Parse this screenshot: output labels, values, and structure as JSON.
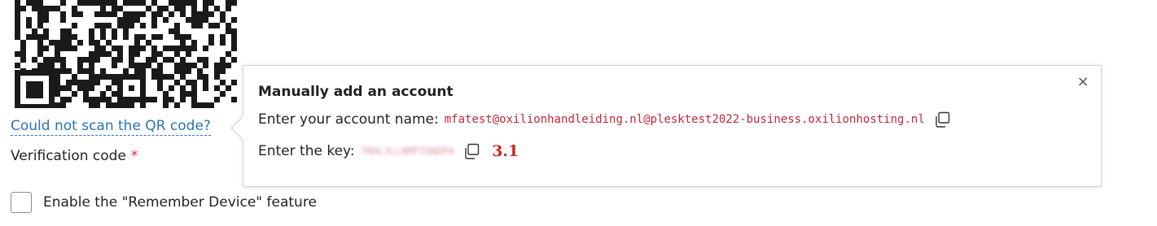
{
  "qr": {
    "icon": "qr-code"
  },
  "links": {
    "cannot_scan": "Could not scan the QR code?"
  },
  "form": {
    "verification_label": "Verification code",
    "required_marker": "*",
    "remember_label": "Enable the \"Remember Device\" feature"
  },
  "popover": {
    "title": "Manually add an account",
    "close_symbol": "×",
    "account_label": "Enter your account name:",
    "account_value": "mfatest@oxilionhandleiding.nl@plesktest2022-business.oxilionhosting.nl",
    "key_label": "Enter the key:",
    "key_value": "7RHL3LLNMF5SNDPA",
    "step_annotation": "3.1"
  },
  "colors": {
    "link": "#2a73b8",
    "mono_value": "#c0283a",
    "required": "#d9262e",
    "annotation": "#c42a1f"
  }
}
